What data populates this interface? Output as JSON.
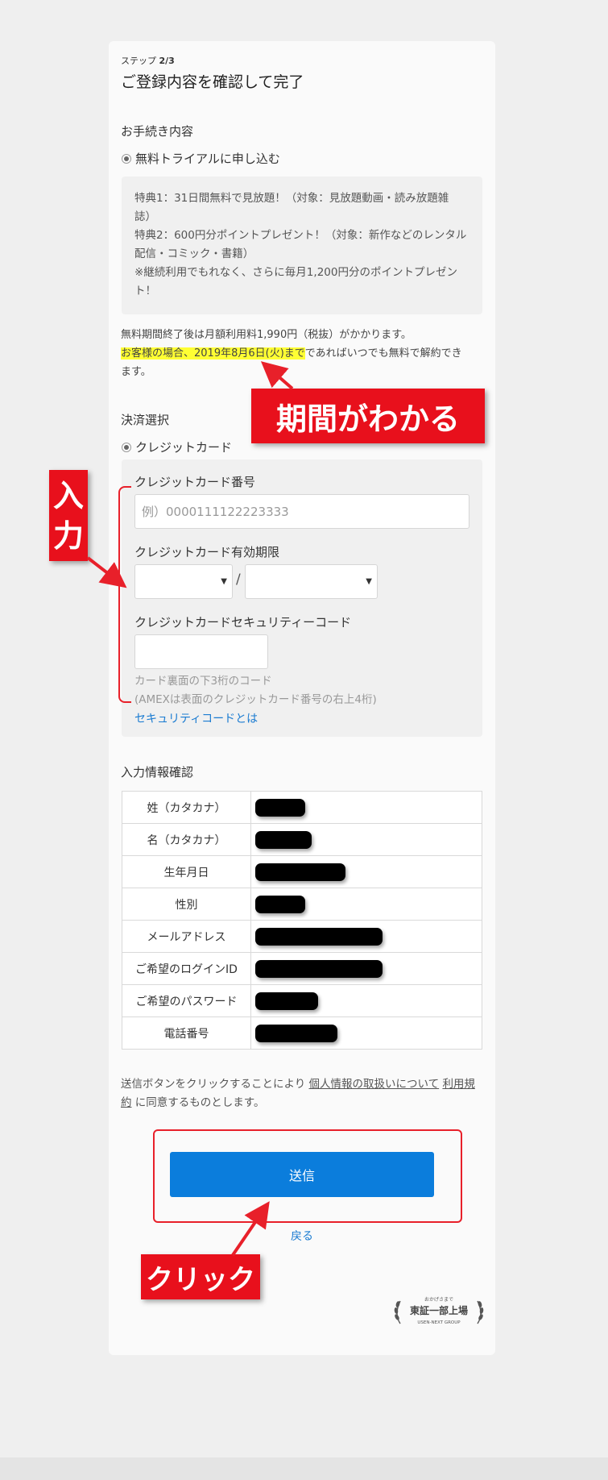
{
  "step": {
    "prefix": "ステップ",
    "value": "2/3"
  },
  "page_title": "ご登録内容を確認して完了",
  "procedure": {
    "label": "お手続き内容",
    "option": "無料トライアルに申し込む",
    "benefits": [
      "特典1：31日間無料で見放題！（対象：見放題動画・読み放題雑",
      "誌）",
      "特典2：600円分ポイントプレゼント！（対象：新作などのレンタル",
      "配信・コミック・書籍）",
      "※継続利用でもれなく、さらに毎月1,200円分のポイントプレゼン",
      "ト！"
    ]
  },
  "notice": {
    "line1": "無料期間終了後は月額利用料1,990円（税抜）がかかります。",
    "highlight": "お客様の場合、2019年8月6日(火)まで",
    "rest": "であればいつでも無料で解約でき",
    "line3": "ます。"
  },
  "payment": {
    "label": "決済選択",
    "option": "クレジットカード",
    "card_number_label": "クレジットカード番号",
    "card_number_placeholder": "例）0000111122223333",
    "expiry_label": "クレジットカード有効期限",
    "expiry_separator": "/",
    "cvc_label": "クレジットカードセキュリティーコード",
    "cvc_hint1": "カード裏面の下3桁のコード",
    "cvc_hint2": "(AMEXは表面のクレジットカード番号の右上4桁)",
    "cvc_link": "セキュリティコードとは"
  },
  "confirm": {
    "label": "入力情報確認",
    "rows": [
      {
        "key": "姓（カタカナ）",
        "redact_w": 62
      },
      {
        "key": "名（カタカナ）",
        "redact_w": 70
      },
      {
        "key": "生年月日",
        "redact_w": 112
      },
      {
        "key": "性別",
        "redact_w": 62
      },
      {
        "key": "メールアドレス",
        "redact_w": 158
      },
      {
        "key": "ご希望のログインID",
        "redact_w": 158
      },
      {
        "key": "ご希望のパスワード",
        "redact_w": 78
      },
      {
        "key": "電話番号",
        "redact_w": 102
      }
    ]
  },
  "consent": {
    "pre": "送信ボタンをクリックすることにより ",
    "link1": "個人情報の取扱いについて",
    "mid": " ",
    "link2": "利用規約",
    "post": " に同意するものとします。"
  },
  "submit_label": "送信",
  "back_label": "戻る",
  "logo": {
    "top": "おかげさまで",
    "main": "東証一部上場",
    "bottom": "USEN-NEXT GROUP"
  },
  "annotations": {
    "period": "期間がわかる",
    "input": [
      "入",
      "力"
    ],
    "click": "クリック"
  },
  "colors": {
    "accent": "#0b7ddc",
    "annotation_red": "#e8101c",
    "highlight": "#ffff33"
  }
}
